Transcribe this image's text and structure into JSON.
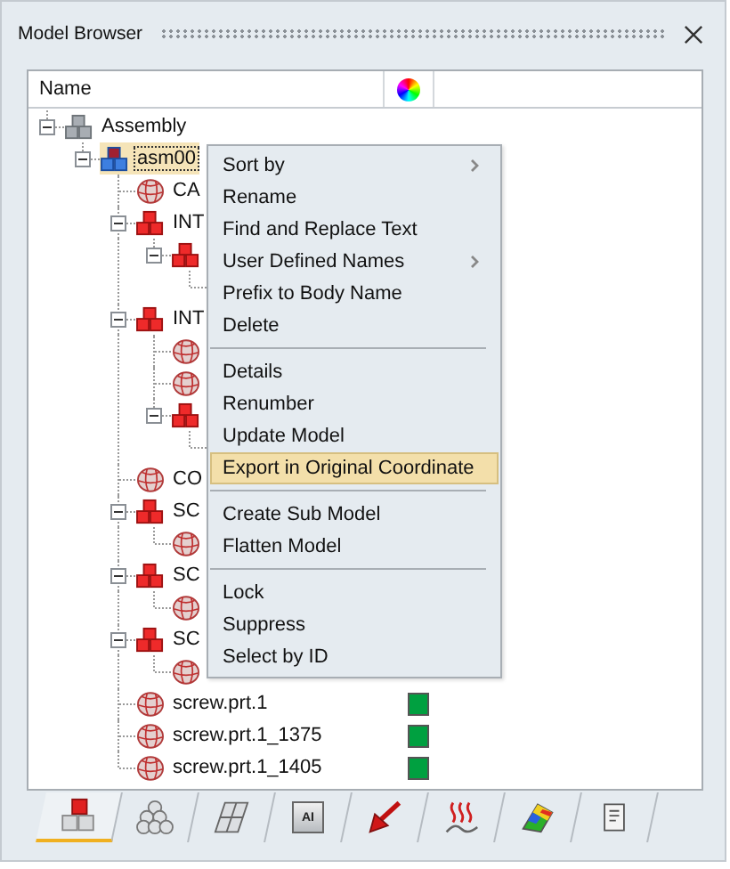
{
  "panel": {
    "title": "Model Browser"
  },
  "tree": {
    "columns": [
      "Name"
    ],
    "nodes": [
      {
        "label": "Assembly",
        "kind": "root",
        "expanded": true,
        "selected": false,
        "children": [
          {
            "label": "asm00",
            "kind": "assembly",
            "expanded": true,
            "selected": true,
            "children": [
              {
                "label": "CA",
                "kind": "part",
                "selected": false
              },
              {
                "label": "INT",
                "kind": "subassembly",
                "expanded": true,
                "selected": false,
                "children": [
                  {
                    "kind": "subassembly",
                    "expanded": true,
                    "selected": false,
                    "children": [
                      {
                        "covered": true
                      }
                    ]
                  }
                ]
              },
              {
                "label": "INT",
                "kind": "subassembly",
                "expanded": true,
                "selected": false,
                "children": [
                  {
                    "kind": "part",
                    "selected": false
                  },
                  {
                    "kind": "part",
                    "selected": false
                  },
                  {
                    "kind": "subassembly",
                    "expanded": true,
                    "selected": false,
                    "children": [
                      {
                        "covered": true
                      }
                    ]
                  }
                ]
              },
              {
                "label": "CO",
                "kind": "part",
                "selected": false
              },
              {
                "label": "SC",
                "kind": "subassembly",
                "expanded": true,
                "selected": false,
                "children": [
                  {
                    "kind": "part",
                    "selected": false
                  }
                ]
              },
              {
                "label": "SC",
                "kind": "subassembly",
                "expanded": true,
                "selected": false,
                "children": [
                  {
                    "kind": "part",
                    "selected": false
                  }
                ]
              },
              {
                "label": "SC",
                "kind": "subassembly",
                "expanded": true,
                "selected": false,
                "children": [
                  {
                    "kind": "part",
                    "selected": false
                  }
                ]
              },
              {
                "label": "screw.prt.1",
                "kind": "part",
                "selected": false,
                "color": "#00a040"
              },
              {
                "label": "screw.prt.1_1375",
                "kind": "part",
                "selected": false,
                "color": "#00a040"
              },
              {
                "label": "screw.prt.1_1405",
                "kind": "part",
                "selected": false,
                "color": "#00a040"
              }
            ]
          }
        ]
      }
    ]
  },
  "context_menu": [
    {
      "kind": "item",
      "label": "Sort by",
      "submenu": true,
      "selected": false
    },
    {
      "kind": "item",
      "label": "Rename",
      "submenu": false,
      "selected": false
    },
    {
      "kind": "item",
      "label": "Find and Replace Text",
      "submenu": false,
      "selected": false
    },
    {
      "kind": "item",
      "label": "User Defined Names",
      "submenu": true,
      "selected": false
    },
    {
      "kind": "item",
      "label": "Prefix to Body Name",
      "submenu": false,
      "selected": false
    },
    {
      "kind": "item",
      "label": "Delete",
      "submenu": false,
      "selected": false
    },
    {
      "kind": "separator"
    },
    {
      "kind": "item",
      "label": "Details",
      "submenu": false,
      "selected": false
    },
    {
      "kind": "item",
      "label": "Renumber",
      "submenu": false,
      "selected": false
    },
    {
      "kind": "item",
      "label": "Update Model",
      "submenu": false,
      "selected": false
    },
    {
      "kind": "item",
      "label": "Export in Original Coordinate",
      "submenu": false,
      "selected": true
    },
    {
      "kind": "separator"
    },
    {
      "kind": "item",
      "label": "Create Sub Model",
      "submenu": false,
      "selected": false
    },
    {
      "kind": "item",
      "label": "Flatten Model",
      "submenu": false,
      "selected": false
    },
    {
      "kind": "separator"
    },
    {
      "kind": "item",
      "label": "Lock",
      "submenu": false,
      "selected": false
    },
    {
      "kind": "item",
      "label": "Suppress",
      "submenu": false,
      "selected": false
    },
    {
      "kind": "item",
      "label": "Select by ID",
      "submenu": false,
      "selected": false
    }
  ],
  "tabs": [
    {
      "kind": "parts",
      "selected": true
    },
    {
      "kind": "spheres",
      "selected": false
    },
    {
      "kind": "plates",
      "selected": false
    },
    {
      "kind": "box",
      "text": "AI",
      "selected": false
    },
    {
      "kind": "arrow",
      "selected": false
    },
    {
      "kind": "heat",
      "selected": false
    },
    {
      "kind": "rainbow",
      "selected": false
    },
    {
      "kind": "script",
      "selected": false
    }
  ]
}
